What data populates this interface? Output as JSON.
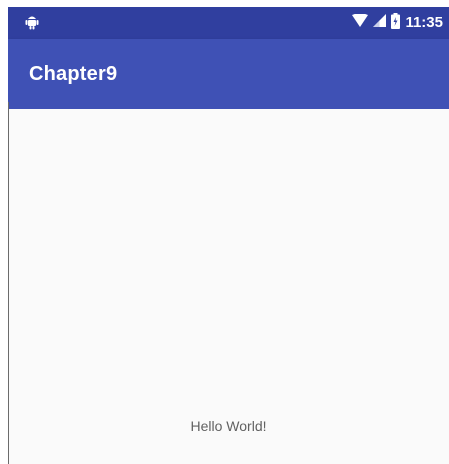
{
  "status_bar": {
    "time": "11:35",
    "left_icon": "android-icon",
    "right_icons": [
      "wifi-icon",
      "signal-icon",
      "battery-icon"
    ],
    "color": "#303f9f"
  },
  "app_bar": {
    "title": "Chapter9",
    "color": "#3f51b5"
  },
  "content": {
    "text": "Hello World!",
    "background": "#fafafa"
  }
}
